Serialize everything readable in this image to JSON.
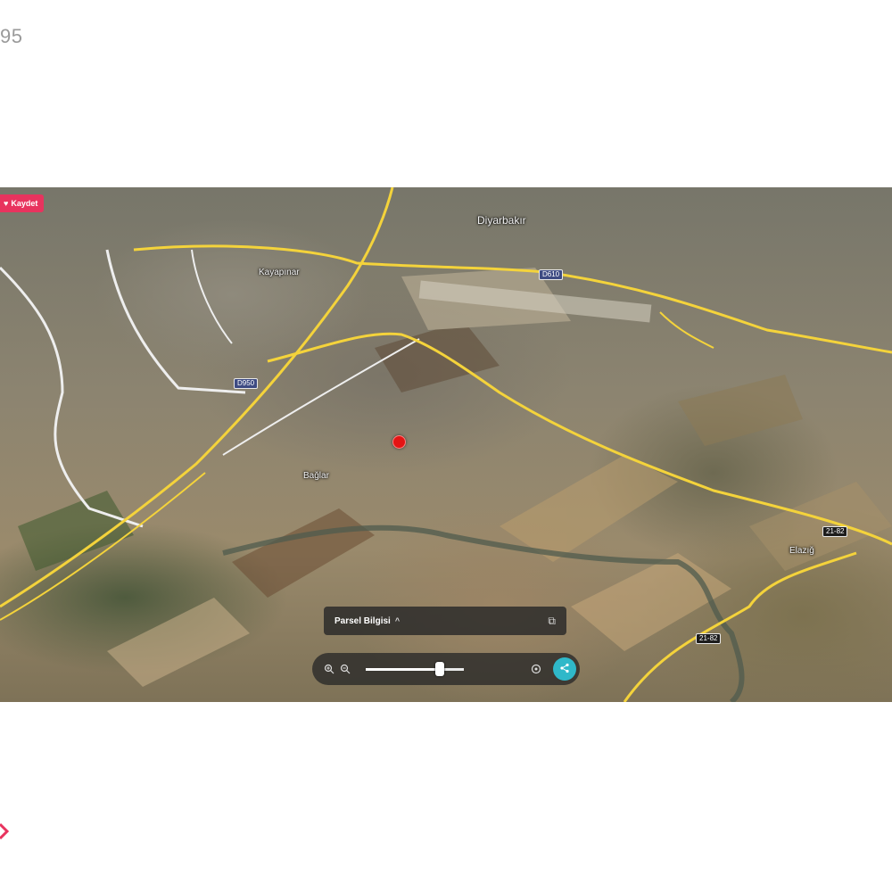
{
  "page": {
    "corner_number": "95"
  },
  "map": {
    "save_label": "Kaydet",
    "labels": {
      "city": "Diyarbakır",
      "district_1": "Kayapınar",
      "district_2": "Bağlar",
      "district_3": "Elazığ"
    },
    "road_shields": {
      "r1": "D950",
      "r2": "21-82",
      "r3": "21-82",
      "r4": "D610"
    }
  },
  "parcel_panel": {
    "title": "Parsel Bilgisi",
    "chevron": "^"
  },
  "controls": {
    "zoom_in_icon": "zoom-in-icon",
    "zoom_out_icon": "zoom-out-icon",
    "zoom_level": 0.75,
    "compass_icon": "compass-icon",
    "share_icon": "share-icon"
  },
  "colors": {
    "save_button": "#e8335e",
    "pin": "#e41414",
    "share_button": "#2fb8c9",
    "road_yellow": "#f4d33b",
    "road_white": "#f2f2f2"
  }
}
